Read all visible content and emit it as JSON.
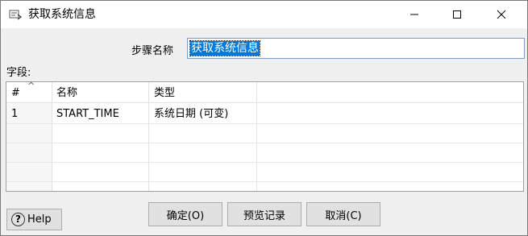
{
  "window": {
    "title": "获取系统信息"
  },
  "form": {
    "step_name_label": "步骤名称",
    "step_name_value": "获取系统信息",
    "fields_label": "字段:"
  },
  "table": {
    "columns": [
      "#",
      "名称",
      "类型"
    ],
    "rows": [
      {
        "num": "1",
        "name": "START_TIME",
        "type": "系统日期 (可变)"
      }
    ]
  },
  "buttons": {
    "help": "Help",
    "ok": "确定(O)",
    "preview": "预览记录",
    "cancel": "取消(C)"
  }
}
